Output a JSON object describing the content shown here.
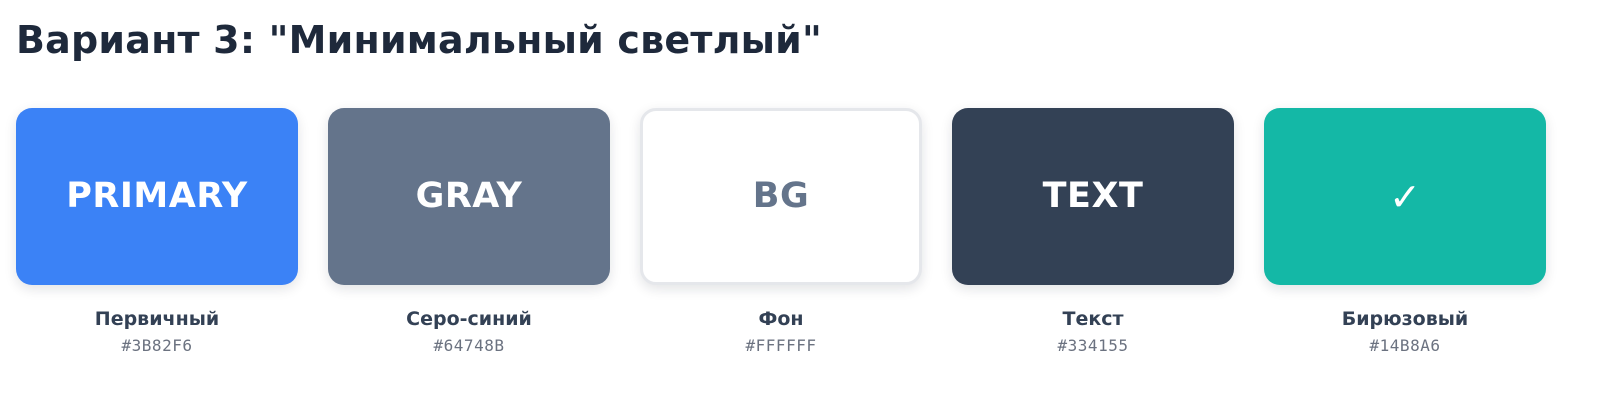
{
  "page_title": "Вариант 3: \"Минимальный светлый\"",
  "swatches": [
    {
      "label": "PRIMARY",
      "name": "Первичный",
      "hex": "#3B82F6",
      "color": "#3B82F6"
    },
    {
      "label": "GRAY",
      "name": "Серо-синий",
      "hex": "#64748B",
      "color": "#64748B"
    },
    {
      "label": "BG",
      "name": "Фон",
      "hex": "#FFFFFF",
      "color": "#FFFFFF"
    },
    {
      "label": "TEXT",
      "name": "Текст",
      "hex": "#334155",
      "color": "#334155"
    },
    {
      "label": "✓",
      "icon": "check-icon",
      "name": "Бирюзовый",
      "hex": "#14B8A6",
      "color": "#14B8A6"
    }
  ]
}
